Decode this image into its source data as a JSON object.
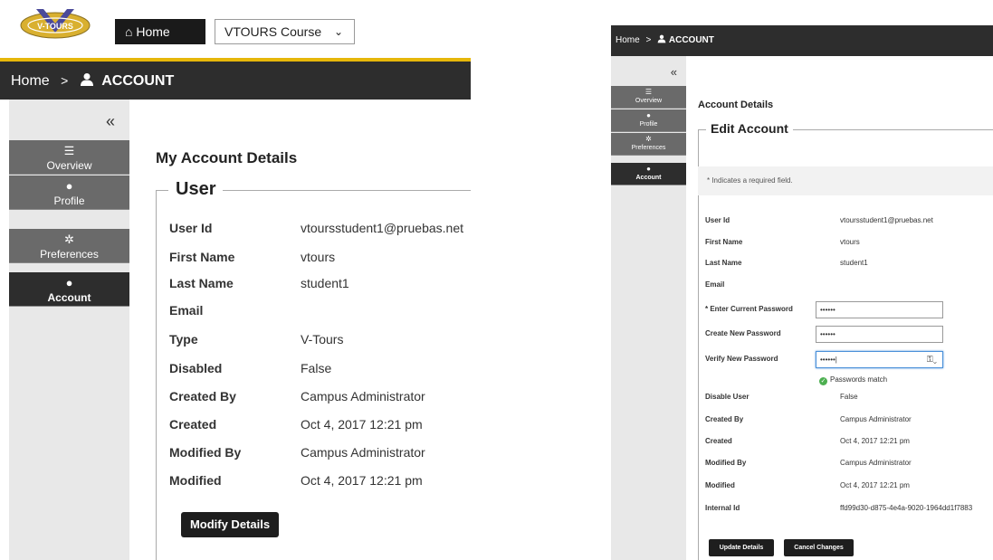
{
  "left": {
    "logo_text": "V-TOURS",
    "home_button": "Home",
    "course_select": "VTOURS Course",
    "breadcrumb": {
      "home": "Home",
      "separator": ">",
      "current": "ACCOUNT"
    },
    "sidebar": [
      {
        "icon": "list-icon",
        "label": "Overview"
      },
      {
        "icon": "person-icon",
        "label": "Profile"
      },
      {
        "icon": "gear-icon",
        "label": "Preferences"
      },
      {
        "icon": "person-icon",
        "label": "Account"
      }
    ],
    "collapse_glyph": "«",
    "title": "My Account Details",
    "legend": "User",
    "fields": [
      {
        "label": "User Id",
        "value": "vtoursstudent1@pruebas.net"
      },
      {
        "label": "First Name",
        "value": "vtours"
      },
      {
        "label": "Last Name",
        "value": "student1"
      },
      {
        "label": "Email",
        "value": ""
      },
      {
        "label": "Type",
        "value": "V-Tours"
      },
      {
        "label": "Disabled",
        "value": "False"
      },
      {
        "label": "Created By",
        "value": "Campus Administrator"
      },
      {
        "label": "Created",
        "value": "Oct 4, 2017 12:21 pm"
      },
      {
        "label": "Modified By",
        "value": "Campus Administrator"
      },
      {
        "label": "Modified",
        "value": "Oct 4, 2017 12:21 pm"
      }
    ],
    "modify_button": "Modify Details"
  },
  "right": {
    "breadcrumb": {
      "home": "Home",
      "separator": ">",
      "current": "ACCOUNT"
    },
    "collapse_glyph": "«",
    "sidebar": [
      {
        "icon": "list-icon",
        "label": "Overview"
      },
      {
        "icon": "person-icon",
        "label": "Profile"
      },
      {
        "icon": "gear-icon",
        "label": "Preferences"
      },
      {
        "icon": "person-icon",
        "label": "Account"
      }
    ],
    "title": "Account Details",
    "legend": "Edit Account",
    "required_note": "* Indicates a required field.",
    "fields": [
      {
        "label": "User Id",
        "value": "vtoursstudent1@pruebas.net"
      },
      {
        "label": "First Name",
        "value": "vtours"
      },
      {
        "label": "Last Name",
        "value": "student1"
      },
      {
        "label": "Email",
        "value": ""
      }
    ],
    "password_fields": [
      {
        "label": "* Enter Current Password",
        "value": "••••••"
      },
      {
        "label": "Create New Password",
        "value": "••••••"
      },
      {
        "label": "Verify New Password",
        "value": "••••••|"
      }
    ],
    "passwords_match": "Passwords match",
    "fields2": [
      {
        "label": "Disable User",
        "value": "False"
      },
      {
        "label": "Created By",
        "value": "Campus Administrator"
      },
      {
        "label": "Created",
        "value": "Oct 4, 2017 12:21 pm"
      },
      {
        "label": "Modified By",
        "value": "Campus Administrator"
      },
      {
        "label": "Modified",
        "value": "Oct 4, 2017 12:21 pm"
      },
      {
        "label": "Internal Id",
        "value": "ffd99d30-d875-4e4a-9020-1964dd1f7883"
      }
    ],
    "update_button": "Update Details",
    "cancel_button": "Cancel Changes"
  },
  "colors": {
    "accent_gold": "#e6b70a",
    "dark_bar": "#2d2d2d",
    "nav_gray": "#6a6a6a"
  }
}
